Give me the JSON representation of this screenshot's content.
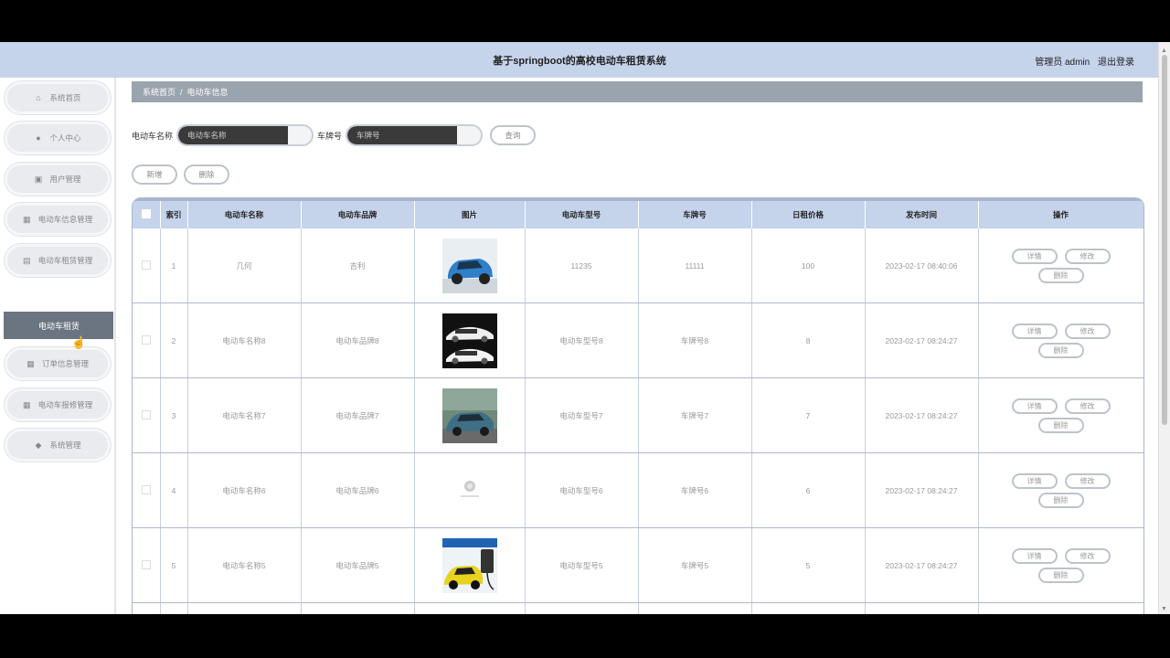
{
  "header": {
    "title": "基于springboot的高校电动车租赁系统",
    "role": "管理员 admin",
    "logout": "退出登录"
  },
  "sidebar": {
    "items": [
      {
        "label": "系统首页",
        "icon": "home-icon"
      },
      {
        "label": "个人中心",
        "icon": "person-icon"
      },
      {
        "label": "用户管理",
        "icon": "clipboard-icon"
      },
      {
        "label": "电动车信息管理",
        "icon": "grid-icon"
      },
      {
        "label": "电动车租赁管理",
        "icon": "document-icon"
      },
      {
        "label": "订单信息管理",
        "icon": "grid-icon"
      },
      {
        "label": "电动车报修管理",
        "icon": "grid-icon"
      },
      {
        "label": "系统管理",
        "icon": "location-icon"
      }
    ],
    "active_sub": "电动车租赁"
  },
  "breadcrumb": {
    "home": "系统首页",
    "sep": "/",
    "current": "电动车信息"
  },
  "search": {
    "name_label": "电动车名称",
    "name_placeholder": "电动车名称",
    "plate_label": "车牌号",
    "plate_placeholder": "车牌号",
    "query_button": "查询"
  },
  "actions": {
    "add": "新增",
    "delete": "删除"
  },
  "table": {
    "headers": [
      "索引",
      "电动车名称",
      "电动车品牌",
      "图片",
      "电动车型号",
      "车牌号",
      "日租价格",
      "发布时间",
      "操作"
    ],
    "op_labels": {
      "detail": "详情",
      "edit": "修改",
      "delete": "删除"
    },
    "rows": [
      {
        "index": "1",
        "name": "几何",
        "brand": "吉利",
        "model": "11235",
        "plate": "11111",
        "price": "100",
        "time": "2023-02-17 08:40:06",
        "image": "blue-suv"
      },
      {
        "index": "2",
        "name": "电动车名称8",
        "brand": "电动车品牌8",
        "model": "电动车型号8",
        "plate": "车牌号8",
        "price": "8",
        "time": "2023-02-17 08:24:27",
        "image": "white-sedans"
      },
      {
        "index": "3",
        "name": "电动车名称7",
        "brand": "电动车品牌7",
        "model": "电动车型号7",
        "plate": "车牌号7",
        "price": "7",
        "time": "2023-02-17 08:24:27",
        "image": "teal-car"
      },
      {
        "index": "4",
        "name": "电动车名称6",
        "brand": "电动车品牌6",
        "model": "电动车型号6",
        "plate": "车牌号6",
        "price": "6",
        "time": "2023-02-17 08:24:27",
        "image": "logo"
      },
      {
        "index": "5",
        "name": "电动车名称5",
        "brand": "电动车品牌5",
        "model": "电动车型号5",
        "plate": "车牌号5",
        "price": "5",
        "time": "2023-02-17 08:24:27",
        "image": "charger"
      }
    ]
  },
  "colors": {
    "header_bg": "#c5d3eb",
    "breadcrumb_bg": "#9aa4ae",
    "active_sub_bg": "#6b7582",
    "input_dark": "#3a3a3a"
  }
}
